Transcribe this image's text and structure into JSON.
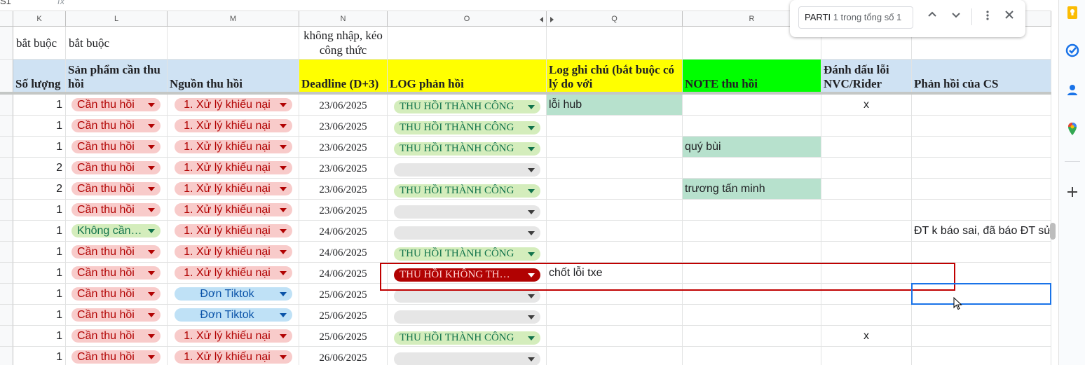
{
  "formula_bar": {
    "name_box": "S1",
    "fx": "fx"
  },
  "columns": [
    "K",
    "L",
    "M",
    "N",
    "O",
    "Q",
    "R",
    "",
    ""
  ],
  "pre_header": {
    "k": "bắt buộc",
    "l": "bắt buộc",
    "n": "không nhập, kéo công thức"
  },
  "headers": {
    "k": "Số lượng",
    "l": "Sản phẩm cần thu hồi",
    "m": "Nguồn thu hồi",
    "n": "Deadline (D+3)",
    "o": "LOG phản hồi",
    "q": "Log ghi chú (bắt buộc có lý do với",
    "r": "NOTE thu hồi",
    "s": "Đánh dấu lỗi NVC/Rider",
    "t": "Phản hồi của CS"
  },
  "rows": [
    {
      "qty": "1",
      "product": "Cần thu hồi",
      "source": "1. Xử lý khiếu nại",
      "deadline": "23/06/2025",
      "log": "THU HỒI THÀNH CÔNG",
      "note_log": "lỗi hub",
      "note": "",
      "mark": "x",
      "cs": ""
    },
    {
      "qty": "1",
      "product": "Cần thu hồi",
      "source": "1. Xử lý khiếu nại",
      "deadline": "23/06/2025",
      "log": "THU HỒI THÀNH CÔNG",
      "note_log": "",
      "note": "",
      "mark": "",
      "cs": ""
    },
    {
      "qty": "1",
      "product": "Cần thu hồi",
      "source": "1. Xử lý khiếu nại",
      "deadline": "23/06/2025",
      "log": "THU HỒI THÀNH CÔNG",
      "note_log": "",
      "note": "quý bùi",
      "mark": "",
      "cs": ""
    },
    {
      "qty": "2",
      "product": "Cần thu hồi",
      "source": "1. Xử lý khiếu nại",
      "deadline": "23/06/2025",
      "log": "",
      "note_log": "",
      "note": "",
      "mark": "",
      "cs": ""
    },
    {
      "qty": "2",
      "product": "Cần thu hồi",
      "source": "1. Xử lý khiếu nại",
      "deadline": "23/06/2025",
      "log": "THU HỒI THÀNH CÔNG",
      "note_log": "",
      "note": "trương tấn minh",
      "mark": "",
      "cs": ""
    },
    {
      "qty": "1",
      "product": "Cần thu hồi",
      "source": "1. Xử lý khiếu nại",
      "deadline": "23/06/2025",
      "log": "",
      "note_log": "",
      "note": "",
      "mark": "",
      "cs": ""
    },
    {
      "qty": "1",
      "product": "Không cần…",
      "source": "1. Xử lý khiếu nại",
      "deadline": "24/06/2025",
      "log": "",
      "note_log": "",
      "note": "",
      "mark": "",
      "cs": "ĐT k báo sai, đã báo ĐT sử"
    },
    {
      "qty": "1",
      "product": "Cần thu hồi",
      "source": "1. Xử lý khiếu nại",
      "deadline": "24/06/2025",
      "log": "THU HỒI THÀNH CÔNG",
      "note_log": "",
      "note": "",
      "mark": "",
      "cs": ""
    },
    {
      "qty": "1",
      "product": "Cần thu hồi",
      "source": "1. Xử lý khiếu nại",
      "deadline": "24/06/2025",
      "log": "THU HỒI KHÔNG TH…",
      "note_log": "chốt lỗi txe",
      "note": "",
      "mark": "",
      "cs": ""
    },
    {
      "qty": "1",
      "product": "Cần thu hồi",
      "source": "Đơn Tiktok",
      "deadline": "25/06/2025",
      "log": "",
      "note_log": "",
      "note": "",
      "mark": "",
      "cs": ""
    },
    {
      "qty": "1",
      "product": "Cần thu hồi",
      "source": "Đơn Tiktok",
      "deadline": "25/06/2025",
      "log": "",
      "note_log": "",
      "note": "",
      "mark": "",
      "cs": ""
    },
    {
      "qty": "1",
      "product": "Cần thu hồi",
      "source": "1. Xử lý khiếu nại",
      "deadline": "25/06/2025",
      "log": "THU HỒI THÀNH CÔNG",
      "note_log": "",
      "note": "",
      "mark": "x",
      "cs": ""
    },
    {
      "qty": "1",
      "product": "Cần thu hồi",
      "source": "1. Xử lý khiếu nại",
      "deadline": "26/06/2025",
      "log": "",
      "note_log": "",
      "note": "",
      "mark": "",
      "cs": ""
    }
  ],
  "find": {
    "query": "PARTI",
    "count": "1 trong tổng số 1"
  },
  "colors": {
    "header_blue": "#cfe2f3",
    "header_yellow": "#ffff00",
    "header_green": "#00ff00",
    "note_green": "#b7e1cd",
    "red_box": "#c00000",
    "selection": "#1a73e8"
  },
  "icons": [
    "up-chevron-icon",
    "down-chevron-icon",
    "more-vert-icon",
    "close-icon",
    "keep-icon",
    "tasks-icon",
    "contacts-icon",
    "maps-icon",
    "add-icon"
  ]
}
